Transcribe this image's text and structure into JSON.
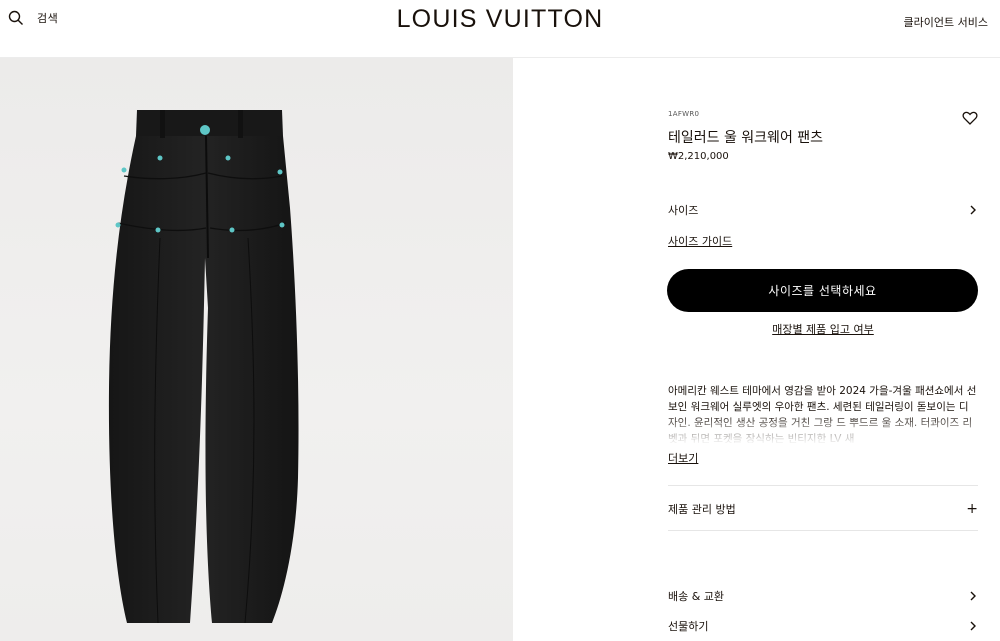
{
  "header": {
    "search_label": "검색",
    "logo": "LOUIS VUITTON",
    "client_service": "클라이언트 서비스"
  },
  "product": {
    "sku": "1AFWR0",
    "title": "테일러드 울 워크웨어 팬츠",
    "price": "₩2,210,000",
    "size_label": "사이즈",
    "size_guide": "사이즈 가이드",
    "cta_label": "사이즈를 선택하세요",
    "store_stock": "매장별 제품 입고 여부",
    "description": "아메리칸 웨스트 테마에서 영감을 받아 2024 가을-겨울 패션쇼에서 선보인 워크웨어 실루엣의 우아한 팬츠. 세련된 테일러링이 돋보이는 디자인. 윤리적인 생산 공정을 거친 그랑 드 뿌드르 울 소재. 터콰이즈 리벳과 뒤면 포켓을 장식하는 빈티지한 LV 새",
    "read_more": "더보기",
    "care_label": "제품 관리 방법",
    "shipping_label": "배송 & 교환",
    "gift_label": "선물하기"
  },
  "colors": {
    "accent": "#000000",
    "text": "#19110b",
    "rivet": "#5ec6c6"
  },
  "icons": {
    "search": "search-icon",
    "wishlist": "heart-icon",
    "chevron": "chevron-right-icon",
    "expand": "plus-icon"
  }
}
